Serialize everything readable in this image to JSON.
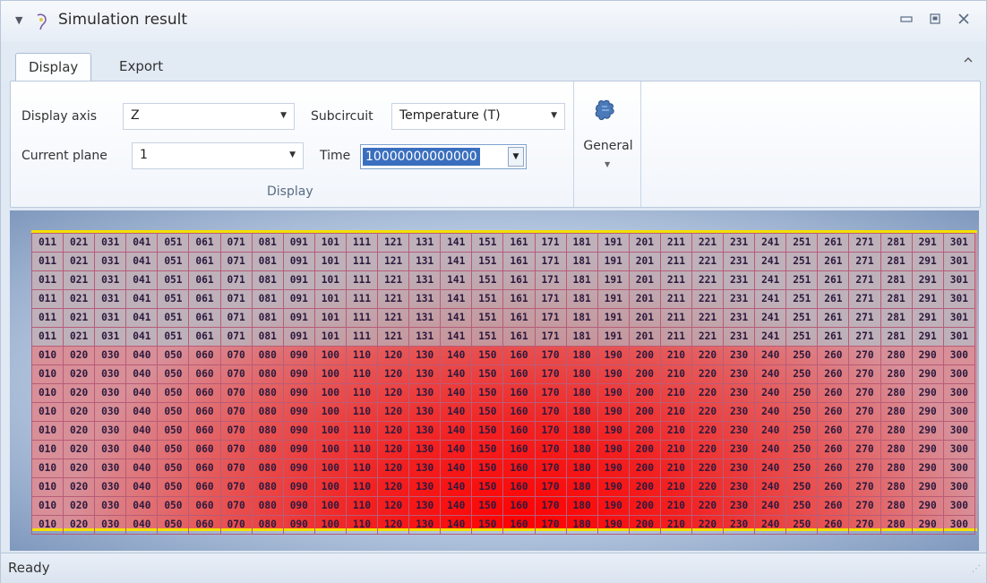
{
  "window": {
    "title": "Simulation result",
    "quick_access_icon": "quick-access-arrow-icon",
    "app_icon": "app-icon",
    "controls": [
      "minimize-icon",
      "restore-icon",
      "close-icon"
    ]
  },
  "tabs": [
    {
      "label": "Display",
      "active": true
    },
    {
      "label": "Export",
      "active": false
    }
  ],
  "ribbon": {
    "display_group": {
      "caption": "Display",
      "display_axis_label": "Display axis",
      "display_axis_value": "Z",
      "subcircuit_label": "Subcircuit",
      "subcircuit_value": "Temperature (T)",
      "current_plane_label": "Current plane",
      "current_plane_value": "1",
      "time_label": "Time",
      "time_value": "10000000000000"
    },
    "general_group": {
      "label": "General",
      "icon": "puzzle-icon"
    }
  },
  "grid": {
    "rows": [
      [
        "011",
        "021",
        "031",
        "041",
        "051",
        "061",
        "071",
        "081",
        "091",
        "101",
        "111",
        "121",
        "131",
        "141",
        "151",
        "161",
        "171",
        "181",
        "191",
        "201",
        "211",
        "221",
        "231",
        "241",
        "251",
        "261",
        "271",
        "281",
        "291",
        "301"
      ],
      [
        "011",
        "021",
        "031",
        "041",
        "051",
        "061",
        "071",
        "081",
        "091",
        "101",
        "111",
        "121",
        "131",
        "141",
        "151",
        "161",
        "171",
        "181",
        "191",
        "201",
        "211",
        "221",
        "231",
        "241",
        "251",
        "261",
        "271",
        "281",
        "291",
        "301"
      ],
      [
        "011",
        "021",
        "031",
        "041",
        "051",
        "061",
        "071",
        "081",
        "091",
        "101",
        "111",
        "121",
        "131",
        "141",
        "151",
        "161",
        "171",
        "181",
        "191",
        "201",
        "211",
        "221",
        "231",
        "241",
        "251",
        "261",
        "271",
        "281",
        "291",
        "301"
      ],
      [
        "011",
        "021",
        "031",
        "041",
        "051",
        "061",
        "071",
        "081",
        "091",
        "101",
        "111",
        "121",
        "131",
        "141",
        "151",
        "161",
        "171",
        "181",
        "191",
        "201",
        "211",
        "221",
        "231",
        "241",
        "251",
        "261",
        "271",
        "281",
        "291",
        "301"
      ],
      [
        "011",
        "021",
        "031",
        "041",
        "051",
        "061",
        "071",
        "081",
        "091",
        "101",
        "111",
        "121",
        "131",
        "141",
        "151",
        "161",
        "171",
        "181",
        "191",
        "201",
        "211",
        "221",
        "231",
        "241",
        "251",
        "261",
        "271",
        "281",
        "291",
        "301"
      ],
      [
        "011",
        "021",
        "031",
        "041",
        "051",
        "061",
        "071",
        "081",
        "091",
        "101",
        "111",
        "121",
        "131",
        "141",
        "151",
        "161",
        "171",
        "181",
        "191",
        "201",
        "211",
        "221",
        "231",
        "241",
        "251",
        "261",
        "271",
        "281",
        "291",
        "301"
      ],
      [
        "010",
        "020",
        "030",
        "040",
        "050",
        "060",
        "070",
        "080",
        "090",
        "100",
        "110",
        "120",
        "130",
        "140",
        "150",
        "160",
        "170",
        "180",
        "190",
        "200",
        "210",
        "220",
        "230",
        "240",
        "250",
        "260",
        "270",
        "280",
        "290",
        "300"
      ],
      [
        "010",
        "020",
        "030",
        "040",
        "050",
        "060",
        "070",
        "080",
        "090",
        "100",
        "110",
        "120",
        "130",
        "140",
        "150",
        "160",
        "170",
        "180",
        "190",
        "200",
        "210",
        "220",
        "230",
        "240",
        "250",
        "260",
        "270",
        "280",
        "290",
        "300"
      ],
      [
        "010",
        "020",
        "030",
        "040",
        "050",
        "060",
        "070",
        "080",
        "090",
        "100",
        "110",
        "120",
        "130",
        "140",
        "150",
        "160",
        "170",
        "180",
        "190",
        "200",
        "210",
        "220",
        "230",
        "240",
        "250",
        "260",
        "270",
        "280",
        "290",
        "300"
      ],
      [
        "010",
        "020",
        "030",
        "040",
        "050",
        "060",
        "070",
        "080",
        "090",
        "100",
        "110",
        "120",
        "130",
        "140",
        "150",
        "160",
        "170",
        "180",
        "190",
        "200",
        "210",
        "220",
        "230",
        "240",
        "250",
        "260",
        "270",
        "280",
        "290",
        "300"
      ],
      [
        "010",
        "020",
        "030",
        "040",
        "050",
        "060",
        "070",
        "080",
        "090",
        "100",
        "110",
        "120",
        "130",
        "140",
        "150",
        "160",
        "170",
        "180",
        "190",
        "200",
        "210",
        "220",
        "230",
        "240",
        "250",
        "260",
        "270",
        "280",
        "290",
        "300"
      ],
      [
        "010",
        "020",
        "030",
        "040",
        "050",
        "060",
        "070",
        "080",
        "090",
        "100",
        "110",
        "120",
        "130",
        "140",
        "150",
        "160",
        "170",
        "180",
        "190",
        "200",
        "210",
        "220",
        "230",
        "240",
        "250",
        "260",
        "270",
        "280",
        "290",
        "300"
      ],
      [
        "010",
        "020",
        "030",
        "040",
        "050",
        "060",
        "070",
        "080",
        "090",
        "100",
        "110",
        "120",
        "130",
        "140",
        "150",
        "160",
        "170",
        "180",
        "190",
        "200",
        "210",
        "220",
        "230",
        "240",
        "250",
        "260",
        "270",
        "280",
        "290",
        "300"
      ],
      [
        "010",
        "020",
        "030",
        "040",
        "050",
        "060",
        "070",
        "080",
        "090",
        "100",
        "110",
        "120",
        "130",
        "140",
        "150",
        "160",
        "170",
        "180",
        "190",
        "200",
        "210",
        "220",
        "230",
        "240",
        "250",
        "260",
        "270",
        "280",
        "290",
        "300"
      ],
      [
        "010",
        "020",
        "030",
        "040",
        "050",
        "060",
        "070",
        "080",
        "090",
        "100",
        "110",
        "120",
        "130",
        "140",
        "150",
        "160",
        "170",
        "180",
        "190",
        "200",
        "210",
        "220",
        "230",
        "240",
        "250",
        "260",
        "270",
        "280",
        "290",
        "300"
      ],
      [
        "010",
        "020",
        "030",
        "040",
        "050",
        "060",
        "070",
        "080",
        "090",
        "100",
        "110",
        "120",
        "130",
        "140",
        "150",
        "160",
        "170",
        "180",
        "190",
        "200",
        "210",
        "220",
        "230",
        "240",
        "250",
        "260",
        "270",
        "280",
        "290",
        "300"
      ]
    ],
    "border_highlight_color": "#f4e000",
    "hot_color": "#ff0000",
    "cool_color": "#d88f98"
  },
  "status": {
    "text": "Ready"
  }
}
